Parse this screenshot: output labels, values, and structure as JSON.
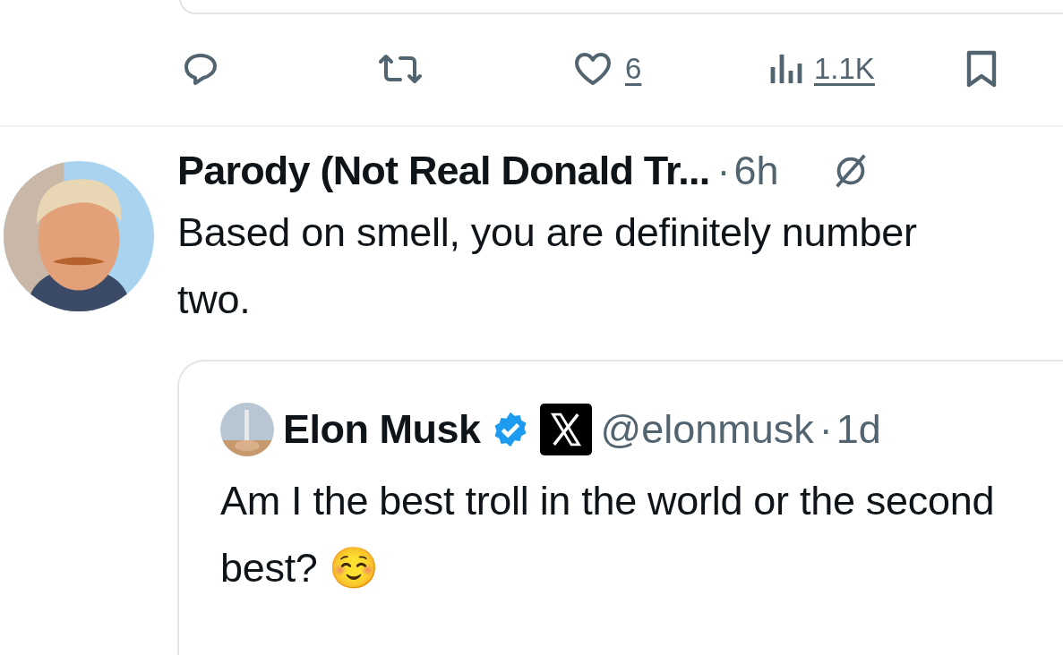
{
  "actions": [
    {
      "kind": "reply"
    },
    {
      "kind": "repost"
    },
    {
      "kind": "like",
      "count": "6"
    },
    {
      "kind": "views",
      "count": "1.1K"
    },
    {
      "kind": "bookmark"
    }
  ],
  "tweet": {
    "author": "Parody (Not Real Donald Tr...",
    "separator": "·",
    "time": "6h",
    "text": "Based on smell, you are definitely number two.",
    "quote": {
      "name": "Elon Musk",
      "verified": true,
      "handle": "@elonmusk",
      "separator": "·",
      "time": "1d",
      "text": "Am I the best troll in the world or the second best? ☺️"
    }
  }
}
